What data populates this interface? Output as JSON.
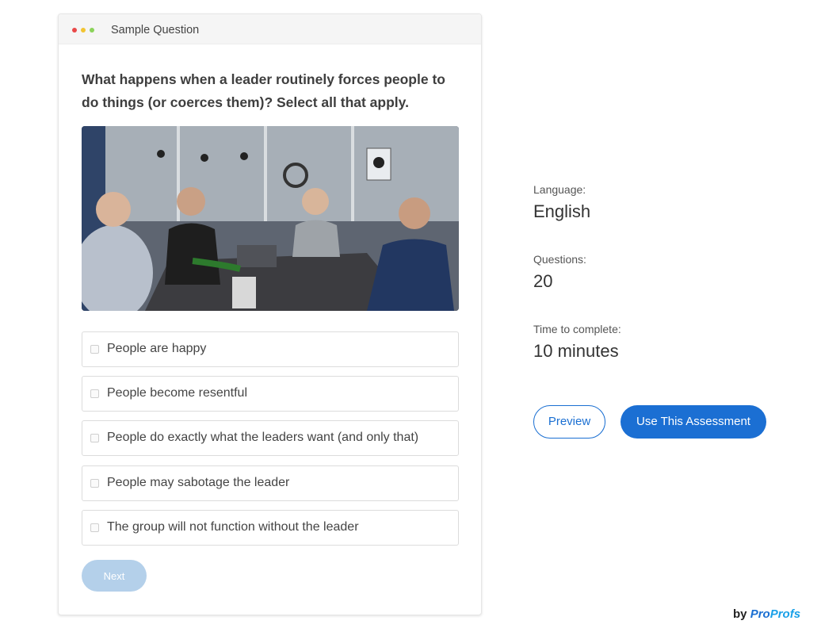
{
  "card": {
    "header_title": "Sample Question",
    "question": "What happens when a leader routinely forces people to do things (or coerces them)? Select all that apply.",
    "options": [
      "People are happy",
      "People become resentful",
      "People do exactly what the leaders want (and only that)",
      "People may sabotage the leader",
      "The group will not function without the leader"
    ],
    "next_label": "Next"
  },
  "details": {
    "language_label": "Language:",
    "language_value": "English",
    "questions_label": "Questions:",
    "questions_value": "20",
    "time_label": "Time to complete:",
    "time_value": "10 minutes"
  },
  "actions": {
    "preview_label": "Preview",
    "use_label": "Use This Assessment"
  },
  "branding": {
    "by": "by",
    "pro": "Pro",
    "profs": "Profs"
  },
  "colors": {
    "accent": "#1b6fd3",
    "next_disabled": "#b4d0ea"
  }
}
